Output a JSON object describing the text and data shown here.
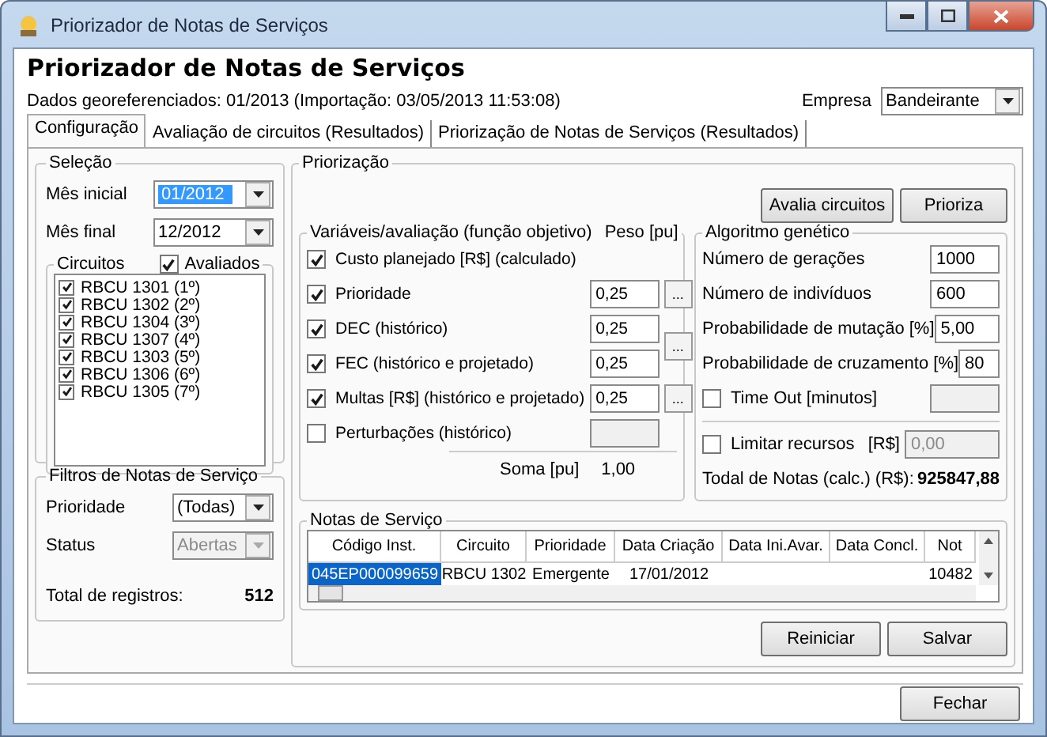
{
  "window": {
    "title": "Priorizador de Notas de Serviços"
  },
  "header": {
    "title": "Priorizador de Notas de Serviços",
    "subtitle": "Dados georeferenciados: 01/2013 (Importação: 03/05/2013 11:53:08)",
    "empresa": {
      "label": "Empresa",
      "value": "Bandeirante"
    }
  },
  "tabs": [
    {
      "label": "Configuração",
      "selected": true
    },
    {
      "label": "Avaliação de circuitos (Resultados)",
      "selected": false
    },
    {
      "label": "Priorização de Notas de Serviços (Resultados)",
      "selected": false
    }
  ],
  "selecao": {
    "title": "Seleção",
    "fields": [
      {
        "label": "Mês inicial",
        "value": "01/2012",
        "selected": true
      },
      {
        "label": "Mês final",
        "value": "12/2012",
        "selected": false
      }
    ],
    "circuitos": {
      "title": "Circuitos",
      "avaliados": {
        "label": "Avaliados",
        "checked": true
      },
      "items": [
        {
          "label": "RBCU  1301 (1º)",
          "checked": true
        },
        {
          "label": "RBCU  1302 (2º)",
          "checked": true
        },
        {
          "label": "RBCU  1304 (3º)",
          "checked": true
        },
        {
          "label": "RBCU  1307 (4º)",
          "checked": true
        },
        {
          "label": "RBCU  1303 (5º)",
          "checked": true
        },
        {
          "label": "RBCU  1306 (6º)",
          "checked": true
        },
        {
          "label": "RBCU  1305 (7º)",
          "checked": true
        }
      ]
    }
  },
  "filtros": {
    "title": "Filtros de Notas de Serviço",
    "fields": [
      {
        "label": "Prioridade",
        "value": "(Todas)",
        "disabled": false
      },
      {
        "label": "Status",
        "value": "Abertas",
        "disabled": true
      }
    ],
    "total": {
      "label": "Total de registros:",
      "value": "512"
    }
  },
  "priorizacao": {
    "title": "Priorização",
    "buttons": [
      "Avalia circuitos",
      "Prioriza"
    ],
    "variaveis": {
      "title": "Variáveis/avaliação (função objetivo)",
      "weight_header": "Peso [pu]",
      "items": [
        {
          "kind": "plain",
          "label": "Custo planejado [R$] (calculado)",
          "checked": true
        },
        {
          "kind": "weighted",
          "label": "Prioridade",
          "checked": true,
          "weight": "0,25",
          "button": "..."
        },
        {
          "kind": "weighted",
          "label": "DEC (histórico)",
          "checked": true,
          "weight": "0,25",
          "button": "..."
        },
        {
          "kind": "weighted",
          "label": "FEC (histórico e projetado)",
          "checked": true,
          "weight": "0,25"
        },
        {
          "kind": "weighted",
          "label": "Multas [R$] (histórico e projetado)",
          "checked": true,
          "weight": "0,25",
          "button": "..."
        },
        {
          "kind": "weighted",
          "label": "Perturbações (histórico)",
          "checked": false
        }
      ],
      "sum": {
        "label": "Soma [pu]",
        "value": "1,00"
      }
    },
    "algoritmo": {
      "title": "Algoritmo genético",
      "rows": [
        {
          "kind": "field",
          "label": "Número de gerações",
          "value": "1000"
        },
        {
          "kind": "field",
          "label": "Número de indivíduos",
          "value": "600"
        },
        {
          "kind": "field",
          "label": "Probabilidade de mutação [%]",
          "value": "5,00"
        },
        {
          "kind": "field",
          "label": "Probabilidade de cruzamento [%]",
          "value": "80"
        },
        {
          "kind": "check",
          "label": "Time Out [minutos]",
          "checked": false
        }
      ],
      "limit": {
        "label": "Limitar recursos",
        "checked": false,
        "unit": "[R$]",
        "value": "0,00"
      },
      "total": {
        "label": "Todal de Notas (calc.) (R$):",
        "value": "925847,88"
      }
    },
    "notas": {
      "title": "Notas de Serviço",
      "columns": [
        "Código Inst.",
        "Circuito",
        "Prioridade",
        "Data Criação",
        "Data Ini.Avar.",
        "Data Concl.",
        "Not"
      ],
      "rows": [
        {
          "selected": true,
          "cells": [
            "045EP000099659",
            "RBCU 1302",
            "Emergente",
            "17/01/2012",
            null,
            null,
            "10482"
          ]
        }
      ]
    },
    "actions": [
      "Reiniciar",
      "Salvar"
    ]
  },
  "footer": {
    "button": "Fechar"
  }
}
